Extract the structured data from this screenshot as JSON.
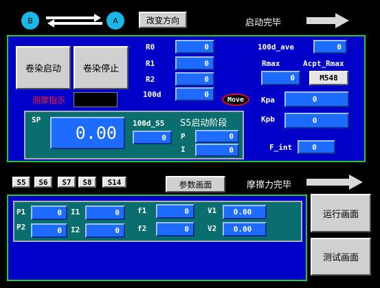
{
  "header": {
    "circle_b": "B",
    "circle_a": "A",
    "change_direction_label": "改变方向",
    "startup_done_label": "启动完毕"
  },
  "panel1": {
    "start_label": "卷染启动",
    "stop_label": "卷染停止",
    "thickness_label": "测厚指示",
    "fields": {
      "r0": {
        "label": "R0",
        "value": "0"
      },
      "r1": {
        "label": "R1",
        "value": "0"
      },
      "r2": {
        "label": "R2",
        "value": "0"
      },
      "d100": {
        "label": "100d",
        "value": "0"
      },
      "d100_ave": {
        "label": "100d_ave",
        "value": "0"
      },
      "rmax": {
        "label": "Rmax",
        "value": "0"
      },
      "kpa": {
        "label": "Kpa",
        "value": "0"
      },
      "kpb": {
        "label": "Kpb",
        "value": "0"
      },
      "f_int": {
        "label": "F_int",
        "value": "0"
      },
      "d100_s5": {
        "label": "100d_S5",
        "value": "0"
      },
      "p": {
        "label": "P",
        "value": "0"
      },
      "i": {
        "label": "I",
        "value": "0"
      }
    },
    "acpt_rmax_label": "Acpt_Rmax",
    "m548_label": "M548",
    "move_label": "Move",
    "sp_label": "SP",
    "sp_value": "0.00",
    "stage_label": "S5启动阶段"
  },
  "middle": {
    "step_buttons": [
      "S5",
      "S6",
      "S7",
      "S8",
      "S14"
    ],
    "param_screen_label": "参数画面",
    "friction_done_label": "摩擦力完毕"
  },
  "panel2": {
    "p1": {
      "label": "P1",
      "value": "0"
    },
    "p2": {
      "label": "P2",
      "value": "0"
    },
    "i1": {
      "label": "I1",
      "value": "0"
    },
    "i2": {
      "label": "I2",
      "value": "0"
    },
    "f1": {
      "label": "f1",
      "value": "0"
    },
    "f2": {
      "label": "f2",
      "value": "0"
    },
    "v1": {
      "label": "V1",
      "value": "0.00"
    },
    "v2": {
      "label": "V2",
      "value": "0.00"
    }
  },
  "right_buttons": {
    "run_screen_label": "运行画面",
    "test_screen_label": "测试画面"
  },
  "colors": {
    "panel_blue": "#0000c8",
    "border_green": "#22cc22",
    "teal": "#0a6e6e",
    "field_blue": "#1e6cff"
  }
}
